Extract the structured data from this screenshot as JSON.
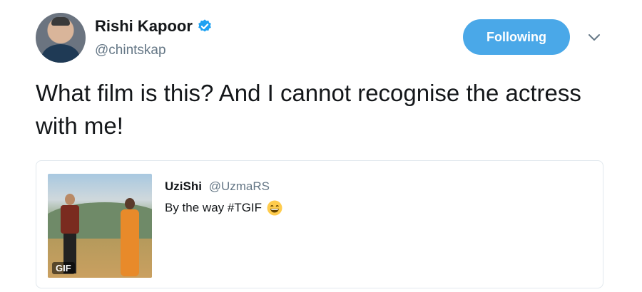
{
  "author": {
    "display_name": "Rishi Kapoor",
    "handle": "@chintskap",
    "verified": true
  },
  "follow_button": {
    "label": "Following"
  },
  "tweet": {
    "text": "What film is this? And I cannot recognise the actress with me!"
  },
  "quoted_tweet": {
    "display_name": "UziShi",
    "handle": "@UzmaRS",
    "text": "By the way #TGIF",
    "media_badge": "GIF",
    "emoji": "grinning-face-icon"
  },
  "colors": {
    "accent": "#4aa8e8",
    "secondary_text": "#657786",
    "border": "#e1e8ed"
  }
}
